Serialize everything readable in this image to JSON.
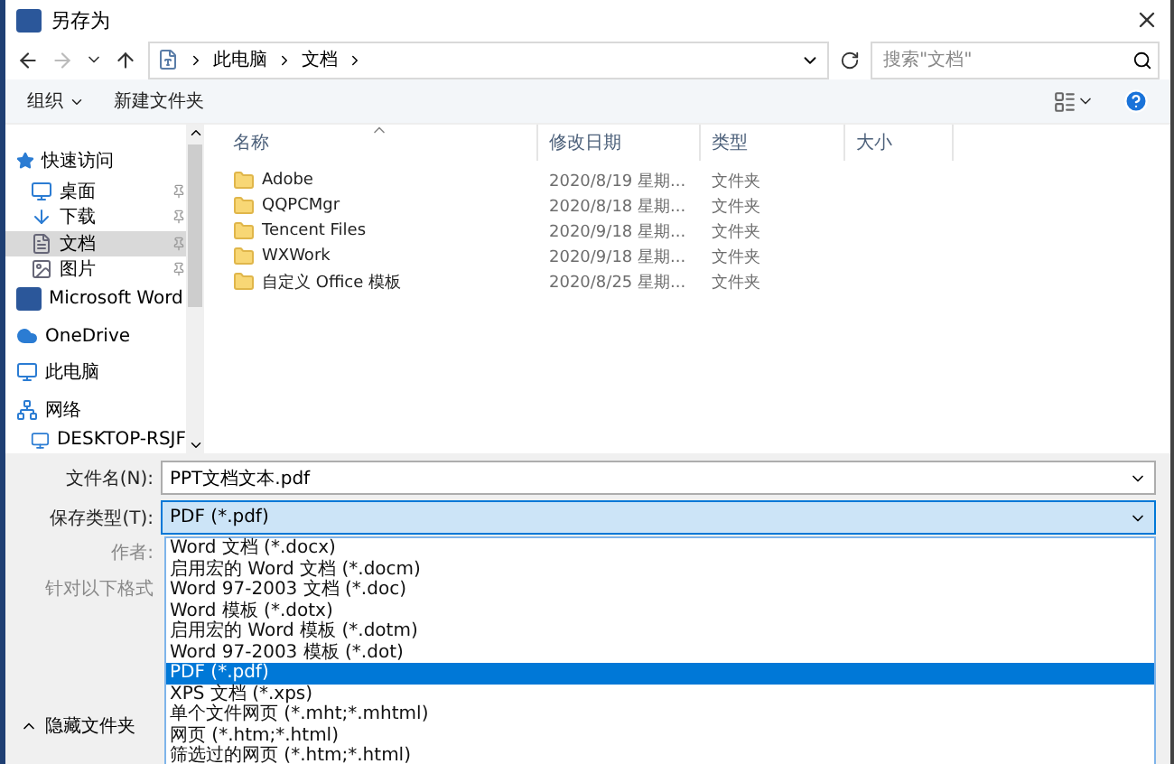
{
  "window": {
    "title": "另存为"
  },
  "breadcrumb": [
    "此电脑",
    "文档"
  ],
  "search": {
    "placeholder": "搜索\"文档\""
  },
  "toolbar": {
    "organize": "组织",
    "new_folder": "新建文件夹"
  },
  "sidebar": {
    "items": [
      {
        "label": "快速访问",
        "kind": "group",
        "pinned": false,
        "selected": false
      },
      {
        "label": "桌面",
        "kind": "item",
        "pinned": true,
        "selected": false
      },
      {
        "label": "下载",
        "kind": "item",
        "pinned": true,
        "selected": false
      },
      {
        "label": "文档",
        "kind": "item",
        "pinned": true,
        "selected": true
      },
      {
        "label": "图片",
        "kind": "item",
        "pinned": true,
        "selected": false
      },
      {
        "label": "Microsoft Word",
        "kind": "group",
        "pinned": false,
        "selected": false
      },
      {
        "label": "OneDrive",
        "kind": "group",
        "pinned": false,
        "selected": false
      },
      {
        "label": "此电脑",
        "kind": "group",
        "pinned": false,
        "selected": false
      },
      {
        "label": "网络",
        "kind": "group",
        "pinned": false,
        "selected": false
      },
      {
        "label": "DESKTOP-RSJF",
        "kind": "item",
        "pinned": false,
        "selected": false
      }
    ]
  },
  "table": {
    "columns": [
      "名称",
      "修改日期",
      "类型",
      "大小"
    ],
    "rows": [
      {
        "name": "Adobe",
        "modified": "2020/8/19 星期...",
        "type": "文件夹"
      },
      {
        "name": "QQPCMgr",
        "modified": "2020/8/18 星期...",
        "type": "文件夹"
      },
      {
        "name": "Tencent Files",
        "modified": "2020/9/18 星期...",
        "type": "文件夹"
      },
      {
        "name": "WXWork",
        "modified": "2020/9/18 星期...",
        "type": "文件夹"
      },
      {
        "name": "自定义 Office 模板",
        "modified": "2020/8/25 星期...",
        "type": "文件夹"
      }
    ]
  },
  "form": {
    "filename_label": "文件名(N):",
    "filename": "PPT文档文本.pdf",
    "type_label": "保存类型(T):",
    "type": "PDF (*.pdf)",
    "author_label": "作者:",
    "optimize_label": "针对以下格式"
  },
  "type_options": [
    {
      "label": "Word 文档 (*.docx)",
      "selected": false
    },
    {
      "label": "启用宏的 Word 文档 (*.docm)",
      "selected": false
    },
    {
      "label": "Word 97-2003 文档 (*.doc)",
      "selected": false
    },
    {
      "label": "Word 模板 (*.dotx)",
      "selected": false
    },
    {
      "label": "启用宏的 Word 模板 (*.dotm)",
      "selected": false
    },
    {
      "label": "Word 97-2003 模板 (*.dot)",
      "selected": false
    },
    {
      "label": "PDF (*.pdf)",
      "selected": true
    },
    {
      "label": "XPS 文档 (*.xps)",
      "selected": false
    },
    {
      "label": "单个文件网页 (*.mht;*.mhtml)",
      "selected": false
    },
    {
      "label": "网页 (*.htm;*.html)",
      "selected": false
    },
    {
      "label": "筛选过的网页 (*.htm;*.html)",
      "selected": false
    }
  ],
  "hide_folders": "隐藏文件夹"
}
